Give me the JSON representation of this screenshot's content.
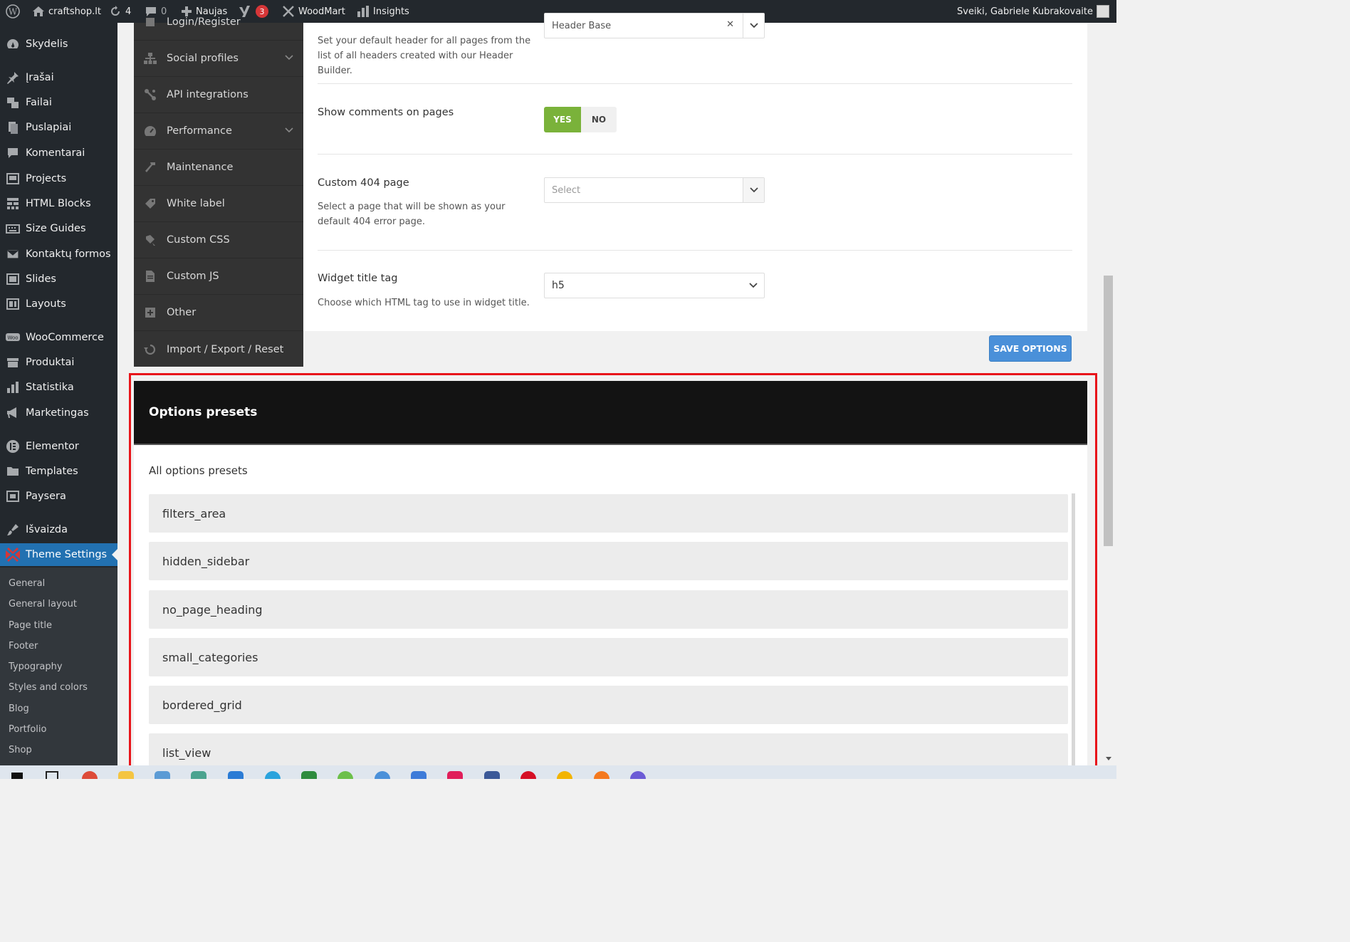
{
  "admin_bar": {
    "site_name": "craftshop.lt",
    "updates_count": "4",
    "comments_count": "0",
    "new_label": "Naujas",
    "yoast_badge": "3",
    "woodmart_label": "WoodMart",
    "insights_label": "Insights",
    "greeting": "Sveiki, Gabriele Kubrakovaite"
  },
  "sidebar": {
    "items": [
      {
        "label": "Skydelis",
        "icon": "dashboard-icon"
      },
      {
        "label": "Įrašai",
        "icon": "pin-icon"
      },
      {
        "label": "Failai",
        "icon": "media-icon"
      },
      {
        "label": "Puslapiai",
        "icon": "pages-icon"
      },
      {
        "label": "Komentarai",
        "icon": "comment-icon"
      },
      {
        "label": "Projects",
        "icon": "portfolio-icon"
      },
      {
        "label": "HTML Blocks",
        "icon": "blocks-icon"
      },
      {
        "label": "Size Guides",
        "icon": "keyboard-icon"
      },
      {
        "label": "Kontaktų formos",
        "icon": "mail-icon"
      },
      {
        "label": "Slides",
        "icon": "slides-icon"
      },
      {
        "label": "Layouts",
        "icon": "layouts-icon"
      },
      {
        "label": "WooCommerce",
        "icon": "woo-icon"
      },
      {
        "label": "Produktai",
        "icon": "archive-icon"
      },
      {
        "label": "Statistika",
        "icon": "chart-icon"
      },
      {
        "label": "Marketingas",
        "icon": "megaphone-icon"
      },
      {
        "label": "Elementor",
        "icon": "elementor-icon"
      },
      {
        "label": "Templates",
        "icon": "folder-icon"
      },
      {
        "label": "Paysera",
        "icon": "paysera-icon"
      },
      {
        "label": "Išvaizda",
        "icon": "brush-icon"
      },
      {
        "label": "Theme Settings",
        "icon": "theme-settings-icon"
      }
    ],
    "submenu": [
      "General",
      "General layout",
      "Page title",
      "Footer",
      "Typography",
      "Styles and colors",
      "Blog",
      "Portfolio",
      "Shop"
    ]
  },
  "theme_nav": {
    "items": [
      {
        "label": "Login/Register",
        "icon": "login-icon"
      },
      {
        "label": "Social profiles",
        "icon": "sitemap-icon"
      },
      {
        "label": "API integrations",
        "icon": "api-icon"
      },
      {
        "label": "Performance",
        "icon": "gauge-icon"
      },
      {
        "label": "Maintenance",
        "icon": "hammer-icon"
      },
      {
        "label": "White label",
        "icon": "tag-icon"
      },
      {
        "label": "Custom CSS",
        "icon": "paint-icon"
      },
      {
        "label": "Custom JS",
        "icon": "file-icon"
      },
      {
        "label": "Other",
        "icon": "other-icon"
      },
      {
        "label": "Import / Export / Reset",
        "icon": "reset-icon"
      }
    ]
  },
  "options": {
    "header_select_value": "Header Base",
    "header_desc": "Set your default header for all pages from the list of all headers created with our Header Builder.",
    "comments_title": "Show comments on pages",
    "yes_label": "YES",
    "no_label": "NO",
    "page404_title": "Custom 404 page",
    "page404_placeholder": "Select",
    "page404_desc": "Select a page that will be shown as your default 404 error page.",
    "widget_title": "Widget title tag",
    "widget_value": "h5",
    "widget_desc": "Choose which HTML tag to use in widget title.",
    "save_label": "SAVE OPTIONS"
  },
  "presets": {
    "title": "Options presets",
    "subtitle": "All options presets",
    "items": [
      "filters_area",
      "hidden_sidebar",
      "no_page_heading",
      "small_categories",
      "bordered_grid",
      "list_view"
    ]
  },
  "colors": {
    "admin_bar_bg": "#23282d",
    "active_menu": "#2271b1",
    "toggle_yes": "#7ab23a",
    "save_button": "#4a90d9",
    "highlight": "#e8141a"
  }
}
